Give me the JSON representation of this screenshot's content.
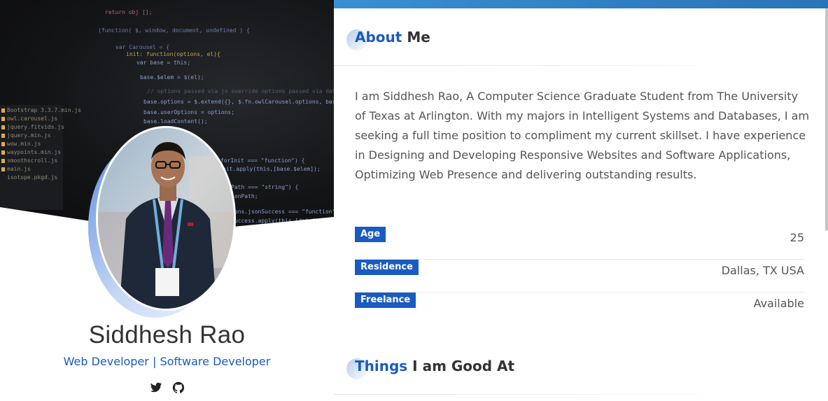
{
  "profile": {
    "name": "Siddhesh Rao",
    "roles": "Web Developer | Software Developer",
    "social": [
      {
        "icon": "twitter-icon"
      },
      {
        "icon": "github-icon"
      }
    ]
  },
  "about": {
    "title_accent": "About",
    "title_rest": "Me",
    "text": "I am Siddhesh Rao, A Computer Science Graduate Student from The University of Texas at Arlington. With my majors in Intelligent Systems and Databases, I am seeking a full time position to compliment my current skillset. I have experience in Designing and Developing Responsive Websites and Software Applications, Optimizing Web Presence and delivering outstanding results.",
    "info": [
      {
        "label": "Age",
        "value": "25"
      },
      {
        "label": "Residence",
        "value": "Dallas, TX USA"
      },
      {
        "label": "Freelance",
        "value": "Available"
      }
    ]
  },
  "skills": {
    "title_accent": "Things",
    "title_rest": "I am Good At"
  },
  "colors": {
    "accent": "#1a5bbf",
    "topbar": "#3a8fd0"
  }
}
